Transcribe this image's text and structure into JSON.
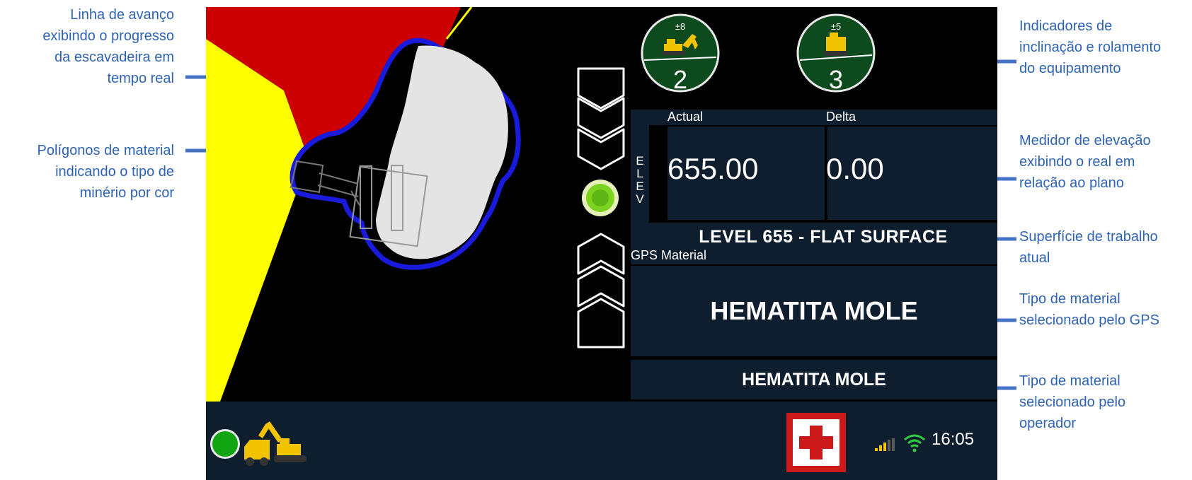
{
  "annotations": {
    "left": [
      "Linha de avanço exibindo o progresso da escavadeira em tempo real",
      "Polígonos de material indicando o tipo de minério por cor"
    ],
    "right": [
      "Indicadores de inclinação e rolamento do equipamento",
      "Medidor de elevação exibindo o real em relação ao plano",
      "Superfície de trabalho atual",
      "Tipo de material selecionado pelo GPS",
      "Tipo de material selecionado pelo operador"
    ]
  },
  "annotation_lines": {
    "advance_line": [
      "Linha de avanço",
      "exibindo o progresso",
      "da escavadeira em",
      "tempo real"
    ],
    "polygons": [
      "Polígonos de material",
      "indicando o tipo de",
      "minério por cor"
    ],
    "tilt": [
      "Indicadores de",
      "inclinação e rolamento",
      "do equipamento"
    ],
    "elevation": [
      "Medidor de elevação",
      "exibindo o real em",
      "relação ao plano"
    ],
    "surface": [
      "Superfície de trabalho",
      "atual"
    ],
    "gps_material": [
      "Tipo de material",
      "selecionado pelo GPS"
    ],
    "operator_material": [
      "Tipo de material",
      "selecionado pelo",
      "operador"
    ]
  },
  "gauges": {
    "pitch": {
      "limit": "±8",
      "value": "2"
    },
    "roll": {
      "limit": "±5",
      "value": "3"
    }
  },
  "elevation": {
    "actual_label": "Actual",
    "delta_label": "Delta",
    "side_letters": [
      "E",
      "L",
      "E",
      "V"
    ],
    "actual_value": "655.00",
    "delta_value": "0.00"
  },
  "surface": {
    "label": "LEVEL 655 - FLAT SURFACE"
  },
  "gps_material": {
    "header": "GPS Material",
    "value": "HEMATITA MOLE"
  },
  "operator_material": {
    "value": "HEMATITA MOLE"
  },
  "status": {
    "clock": "16:05"
  },
  "colors": {
    "yellow_zone": "#ffff00",
    "red_zone": "#cc0000",
    "cut_area": "#e4e4e4",
    "advance_line": "#1a1adc",
    "gauge_fill": "#0d4a1e",
    "on_grade_indicator": "#7ed321",
    "panel": "#0e1e2e",
    "callout_text": "#2f63b3"
  }
}
